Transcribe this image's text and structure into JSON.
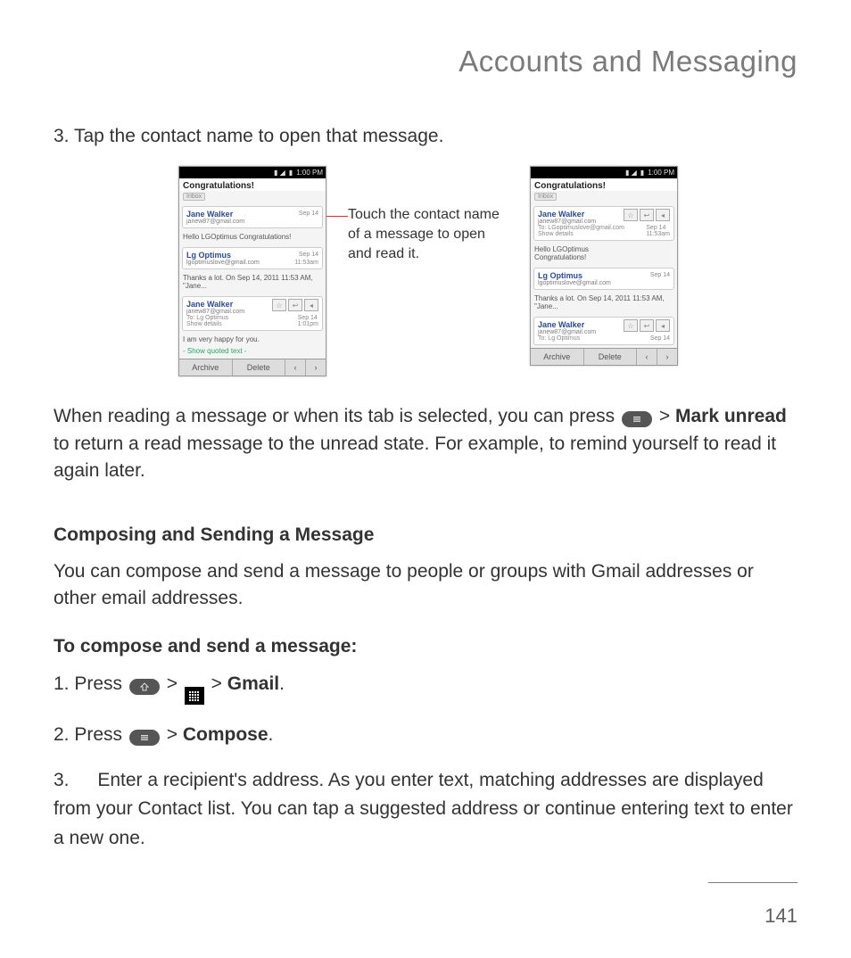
{
  "header": {
    "section_title": "Accounts and Messaging"
  },
  "page_number": "141",
  "body": {
    "step3_num": "3.",
    "step3_text": "Tap the contact name to open that message.",
    "callout": "Touch the contact name of a message to open and read it.",
    "mark_unread_lead": "When reading a message or when its tab is selected, you can press ",
    "mark_unread_sep": " > ",
    "mark_unread_bold": "Mark unread",
    "mark_unread_tail": " to return a read message to the unread state. For example, to remind yourself to read it again later.",
    "compose_heading": "Composing and Sending a Message",
    "compose_intro": "You can compose and send a message to people or groups with Gmail addresses or other email addresses.",
    "compose_sub": "To compose and send a message:",
    "c1_num": "1.",
    "c1_a": "Press ",
    "c1_sep": " > ",
    "c1_gmail": "Gmail",
    "c1_dot": ".",
    "c2_num": "2.",
    "c2_a": "Press ",
    "c2_sep": " > ",
    "c2_compose": "Compose",
    "c2_dot": ".",
    "c3_num": "3.",
    "c3_text": "Enter a recipient's address. As you enter text, matching addresses are displayed from your Contact list. You can tap a suggested address or continue entering text to enter a new one."
  },
  "icon_labels": {
    "menu": "menu-key",
    "home": "home-key",
    "apps": "apps-grid"
  },
  "shots": {
    "status_time": "1:00 PM",
    "subject": "Congratulations!",
    "inbox_label": "Inbox",
    "toolbar": {
      "archive": "Archive",
      "delete": "Delete",
      "prev": "‹",
      "next": "›"
    },
    "left": {
      "m1": {
        "name": "Jane Walker",
        "mail": "janew87@gmail.com",
        "date": "Sep 14"
      },
      "p1": "Hello LGOptimus Congratulations!",
      "m2": {
        "name": "Lg Optimus",
        "mail": "lgoptimuslove@gmail.com",
        "date": "Sep 14",
        "time": "11:53am"
      },
      "p2": "Thanks a lot. On Sep 14, 2011 11:53 AM, \"Jane...",
      "m3": {
        "name": "Jane Walker",
        "mail": "janew87@gmail.com",
        "to_lbl": "To:",
        "to": "Lg Optimus",
        "show": "Show details",
        "date": "Sep 14",
        "time": "1:01pm"
      },
      "body3": "I am very happy for you.",
      "quoted": "- Show quoted text -"
    },
    "right": {
      "m1": {
        "name": "Jane Walker",
        "mail": "janew87@gmail.com",
        "to_lbl": "To:",
        "to": "LGoptimuslove@gmail.com",
        "show": "Show details",
        "date": "Sep 14",
        "time": "11:53am"
      },
      "body1a": "Hello LGOptimus",
      "body1b": "Congratulations!",
      "m2": {
        "name": "Lg Optimus",
        "mail": "lgoptimuslove@gmail.com",
        "date": "Sep 14"
      },
      "p2": "Thanks a lot. On Sep 14, 2011 11:53 AM, \"Jane...",
      "m3": {
        "name": "Jane Walker",
        "mail": "janew87@gmail.com",
        "to_lbl": "To:",
        "to": "Lg Optimus",
        "date": "Sep 14"
      }
    }
  }
}
